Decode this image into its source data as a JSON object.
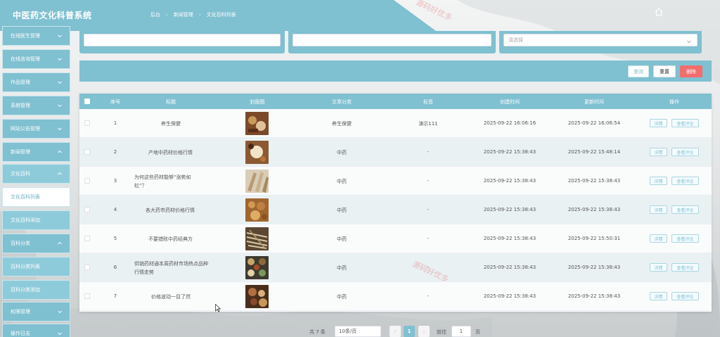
{
  "app": {
    "title": "中医药文化科普系统"
  },
  "breadcrumb": [
    "后台",
    "新闻管理",
    "文化百科列表"
  ],
  "sidebar": {
    "items": [
      {
        "label": "在线医生管理"
      },
      {
        "label": "在线咨询管理"
      },
      {
        "label": "作品管理"
      },
      {
        "label": "系统管理"
      },
      {
        "label": "网站公告管理"
      },
      {
        "label": "新闻管理"
      },
      {
        "label": "文化百科"
      },
      {
        "label": "文化百科列表"
      },
      {
        "label": "文化百科添加"
      },
      {
        "label": "百科分类"
      },
      {
        "label": "百科分类列表"
      },
      {
        "label": "百科分类添加"
      },
      {
        "label": "权限管理"
      },
      {
        "label": "操作日志"
      }
    ]
  },
  "filters": {
    "select_placeholder": "请选择"
  },
  "actions": {
    "query": "查询",
    "reset": "重置",
    "delete": "删除"
  },
  "table": {
    "headers": [
      "序号",
      "标题",
      "封面图",
      "文章分类",
      "标签",
      "创建时间",
      "更新时间",
      "操作"
    ],
    "detail_label": "详情",
    "comment_label": "查看评论",
    "rows": [
      {
        "no": "1",
        "title": "养生保健",
        "category": "养生保健",
        "tag": "演示111",
        "created": "2025-09-22 16:06:16",
        "updated": "2025-09-22 16:06:54"
      },
      {
        "no": "2",
        "title": "产地中药材价格行情",
        "category": "中药",
        "tag": "-",
        "created": "2025-09-22 15:38:43",
        "updated": "2025-09-22 15:48:14"
      },
      {
        "no": "3",
        "title": "为何这些药材能够“涨势如虹”？",
        "category": "中药",
        "tag": "-",
        "created": "2025-09-22 15:38:43",
        "updated": "2025-09-22 15:38:43"
      },
      {
        "no": "4",
        "title": "各大药市药材价格行情",
        "category": "中药",
        "tag": "-",
        "created": "2025-09-22 15:38:43",
        "updated": "2025-09-22 15:38:43"
      },
      {
        "no": "5",
        "title": "不要错败中药经典方",
        "category": "中药",
        "tag": "-",
        "created": "2025-09-22 15:38:43",
        "updated": "2025-09-22 15:50:31"
      },
      {
        "no": "6",
        "title": "供销药材通本周药材市场热点品种行情走势",
        "category": "中药",
        "tag": "-",
        "created": "2025-09-22 15:38:43",
        "updated": "2025-09-22 15:38:43"
      },
      {
        "no": "7",
        "title": "价格波动一目了然",
        "category": "中药",
        "tag": "-",
        "created": "2025-09-22 15:38:43",
        "updated": "2025-09-22 15:38:43"
      }
    ]
  },
  "pagination": {
    "total": "共 7 条",
    "page_size": "10条/页",
    "current": "1",
    "goto_label": "前往",
    "goto_value": "1",
    "page_suffix": "页"
  },
  "watermark": "源码好优多",
  "colors": {
    "primary": "#7fc0d1",
    "danger": "#f56c6c",
    "row_alt": "#eaf1f3"
  },
  "icons": {
    "home": "home-icon",
    "chevron": "chevron-down-icon",
    "cursor": "mouse-cursor-icon"
  }
}
